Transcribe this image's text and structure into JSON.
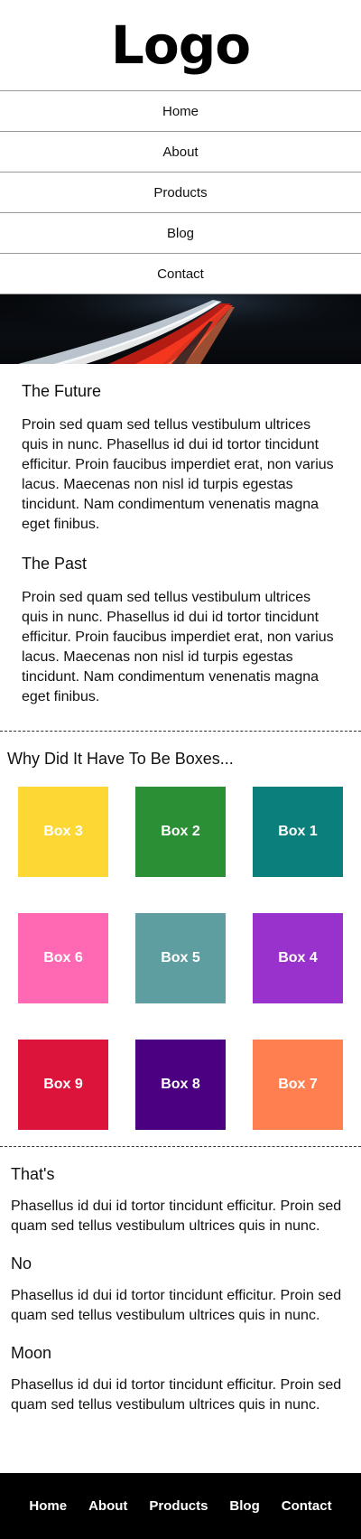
{
  "header": {
    "logo": "Logo"
  },
  "nav": {
    "items": [
      "Home",
      "About",
      "Products",
      "Blog",
      "Contact"
    ]
  },
  "articles": [
    {
      "title": "The Future",
      "body": "Proin sed quam sed tellus vestibulum ultrices quis in nunc. Phasellus id dui id tortor tincidunt efficitur. Proin faucibus imperdiet erat, non varius lacus. Maecenas non nisl id turpis egestas tincidunt. Nam condimentum venenatis magna eget finibus."
    },
    {
      "title": "The Past",
      "body": "Proin sed quam sed tellus vestibulum ultrices quis in nunc. Phasellus id dui id tortor tincidunt efficitur. Proin faucibus imperdiet erat, non varius lacus. Maecenas non nisl id turpis egestas tincidunt. Nam condimentum venenatis magna eget finibus."
    }
  ],
  "boxes": {
    "title": "Why Did It Have To Be Boxes...",
    "items": [
      {
        "label": "Box 3",
        "color": "#FDD835"
      },
      {
        "label": "Box 2",
        "color": "#2A8F35"
      },
      {
        "label": "Box 1",
        "color": "#0A7F7C"
      },
      {
        "label": "Box 6",
        "color": "#FF69B4"
      },
      {
        "label": "Box 5",
        "color": "#5F9EA0"
      },
      {
        "label": "Box 4",
        "color": "#9932CC"
      },
      {
        "label": "Box 9",
        "color": "#DC143C"
      },
      {
        "label": "Box 8",
        "color": "#4B0082"
      },
      {
        "label": "Box 7",
        "color": "#FF7F50"
      }
    ]
  },
  "entries": [
    {
      "title": "That's",
      "body": "Phasellus id dui id tortor tincidunt efficitur. Proin sed quam sed tellus vestibulum ultrices quis in nunc."
    },
    {
      "title": "No",
      "body": "Phasellus id dui id tortor tincidunt efficitur. Proin sed quam sed tellus vestibulum ultrices quis in nunc."
    },
    {
      "title": "Moon",
      "body": "Phasellus id dui id tortor tincidunt efficitur. Proin sed quam sed tellus vestibulum ultrices quis in nunc."
    }
  ],
  "footer": {
    "links": [
      "Home",
      "About",
      "Products",
      "Blog",
      "Contact"
    ]
  }
}
